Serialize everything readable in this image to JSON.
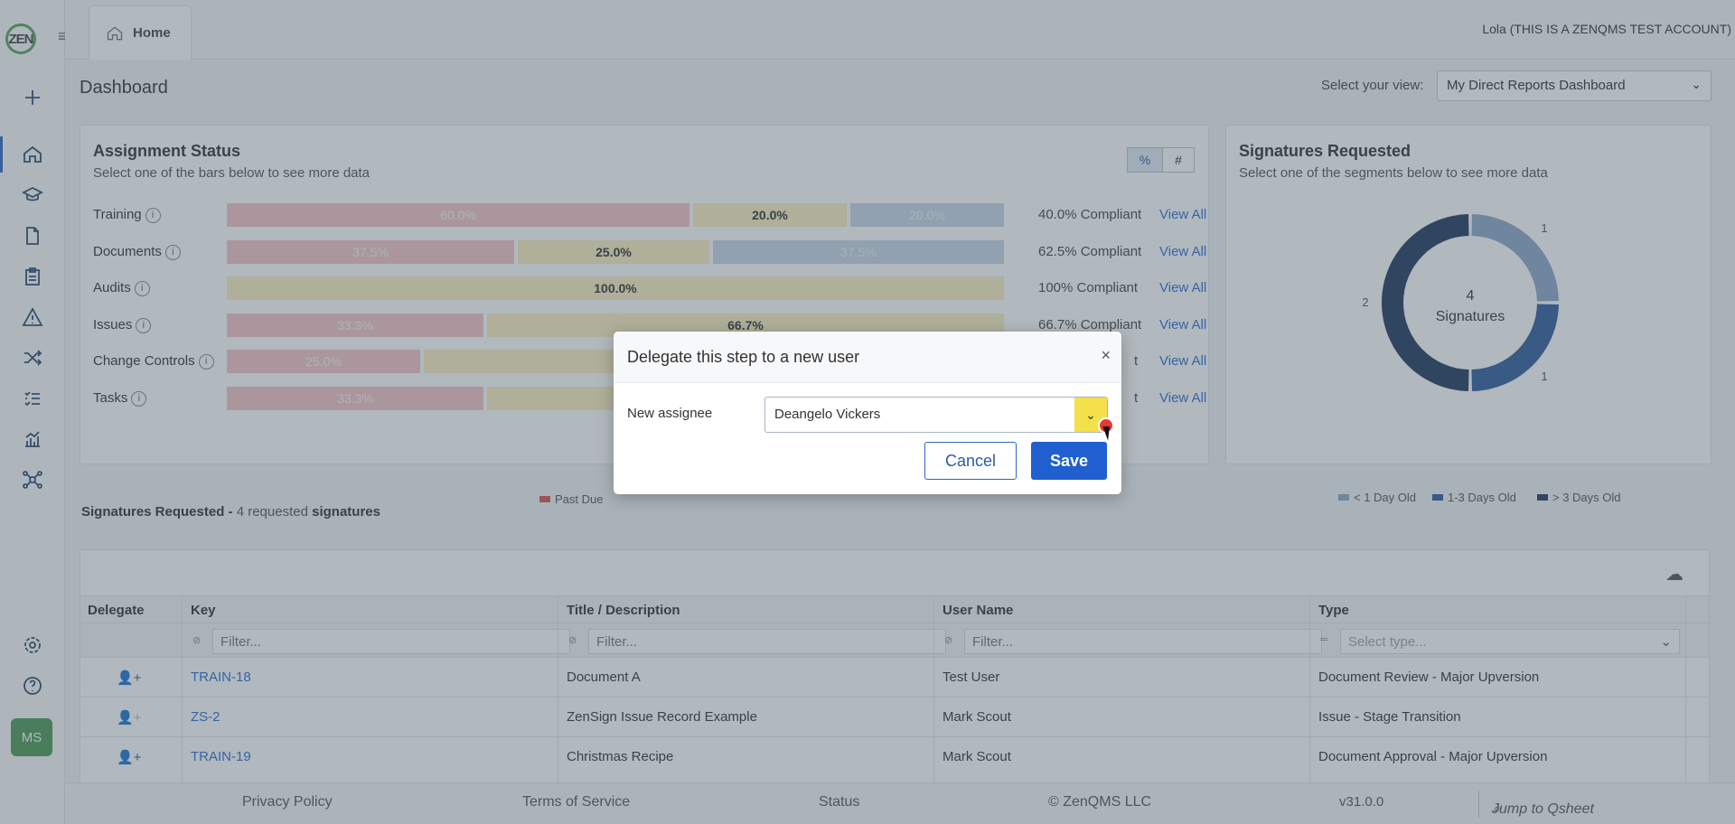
{
  "app": {
    "logo_text": "ZEN",
    "user": "Lola (THIS IS A ZENQMS TEST ACCOUNT)",
    "home_tab": "Home",
    "avatar_initials": "MS"
  },
  "dashboard": {
    "title": "Dashboard",
    "view_label": "Select your view:",
    "view_value": "My Direct Reports Dashboard"
  },
  "assignment_status": {
    "title": "Assignment Status",
    "subtitle": "Select one of the bars below to see more data",
    "toggle_percent": "%",
    "toggle_count": "#",
    "rows": [
      {
        "label": "Training",
        "red": "60.0%",
        "yellow": "20.0%",
        "blue": "20.0%",
        "compliant": "40.0% Compliant",
        "view_all": "View All"
      },
      {
        "label": "Documents",
        "red": "37.5%",
        "yellow": "25.0%",
        "blue": "37.5%",
        "compliant": "62.5% Compliant",
        "view_all": "View All"
      },
      {
        "label": "Audits",
        "yellow": "100.0%",
        "compliant": "100% Compliant",
        "view_all": "View All"
      },
      {
        "label": "Issues",
        "red": "33.3%",
        "yellow": "66.7%",
        "compliant": "66.7% Compliant",
        "view_all": "View All"
      },
      {
        "label": "Change Controls",
        "red": "25.0%",
        "compliant": "t",
        "view_all": "View All"
      },
      {
        "label": "Tasks",
        "red": "33.3%",
        "compliant": "t",
        "view_all": "View All"
      }
    ],
    "legend": [
      "Past Due"
    ]
  },
  "signatures_chart": {
    "title": "Signatures Requested",
    "subtitle": "Select one of the segments below to see more data",
    "center_count": "4",
    "center_label": "Signatures",
    "legend": [
      "< 1 Day Old",
      "1-3 Days Old",
      "> 3 Days Old"
    ],
    "colors": [
      "#8da9c9",
      "#2f5d9c",
      "#213a5e"
    ]
  },
  "chart_data": {
    "type": "pie",
    "categories": [
      "< 1 Day Old",
      "1-3 Days Old",
      "> 3 Days Old"
    ],
    "values": [
      1,
      1,
      2
    ],
    "title": "Signatures Requested"
  },
  "signatures_table": {
    "header_prefix": "Signatures Requested - ",
    "header_count": "4 requested ",
    "header_suffix": "signatures",
    "columns": [
      "Delegate",
      "Key",
      "Title / Description",
      "User Name",
      "Type"
    ],
    "filter_placeholder": "Filter...",
    "type_placeholder": "Select type...",
    "rows": [
      {
        "key": "TRAIN-18",
        "title": "Document A",
        "user": "Test User",
        "type": "Document Review - Major Upversion"
      },
      {
        "key": "ZS-2",
        "title": "ZenSign Issue Record Example",
        "user": "Mark Scout",
        "type": "Issue - Stage Transition"
      },
      {
        "key": "TRAIN-19",
        "title": "Christmas Recipe",
        "user": "Mark Scout",
        "type": "Document Approval - Major Upversion"
      }
    ]
  },
  "footer": {
    "privacy": "Privacy Policy",
    "terms": "Terms of Service",
    "status": "Status",
    "copyright": "© ZenQMS LLC",
    "version": "v31.0.0",
    "jump_placeholder": "Jump to Qsheet"
  },
  "modal": {
    "title": "Delegate this step to a new user",
    "close": "×",
    "assignee_label": "New assignee",
    "assignee_value": "Deangelo Vickers",
    "cancel": "Cancel",
    "save": "Save"
  }
}
